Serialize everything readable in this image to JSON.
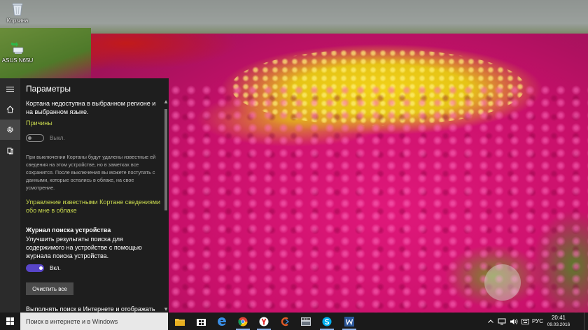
{
  "desktop": {
    "icons": [
      {
        "label": "Корзина",
        "icon": "recycle-bin-icon"
      },
      {
        "label": "ASUS N65U",
        "icon": "network-computer-icon"
      }
    ]
  },
  "cortana_panel": {
    "title": "Параметры",
    "rail": {
      "items": [
        "hamburger-menu-icon",
        "home-icon",
        "settings-icon",
        "notebook-icon"
      ],
      "active": "settings-icon"
    },
    "unavailable_text": "Кортана недоступна в выбранном регионе и на выбранном языке.",
    "reasons_link": "Причины",
    "cortana_toggle": {
      "state": "off",
      "label": "Выкл."
    },
    "info_text": "При выключении Кортаны будут удалены известные ей сведения на этом устройстве, но в заметках все сохранится. После выключения вы можете поступать с данными, которые остались в облаке, на свое усмотрение.",
    "manage_link": "Управление известными Кортане сведениями обо мне в облаке",
    "device_history": {
      "heading": "Журнал поиска устройства",
      "description": "Улучшить результаты поиска для содержимого на устройстве с помощью журнала поиска устройства.",
      "toggle": {
        "state": "on",
        "label": "Вкл."
      },
      "clear_button": "Очистить все"
    },
    "web_search_text": "Выполнять поиск в Интернете и отображать",
    "colors": {
      "accent": "#5845c8",
      "link": "#c9d94e"
    }
  },
  "taskbar": {
    "search_placeholder": "Поиск в интернете и в Windows",
    "apps": [
      "file-explorer-icon",
      "store-icon",
      "edge-icon",
      "chrome-icon",
      "yandex-browser-icon",
      "ccleaner-icon",
      "media-player-icon",
      "skype-icon",
      "word-icon"
    ],
    "tray": {
      "icons": [
        "chevron-up-icon",
        "network-icon",
        "volume-icon",
        "keyboard-icon"
      ],
      "language": "РУС",
      "time": "20:41",
      "date": "09.03.2016"
    }
  }
}
